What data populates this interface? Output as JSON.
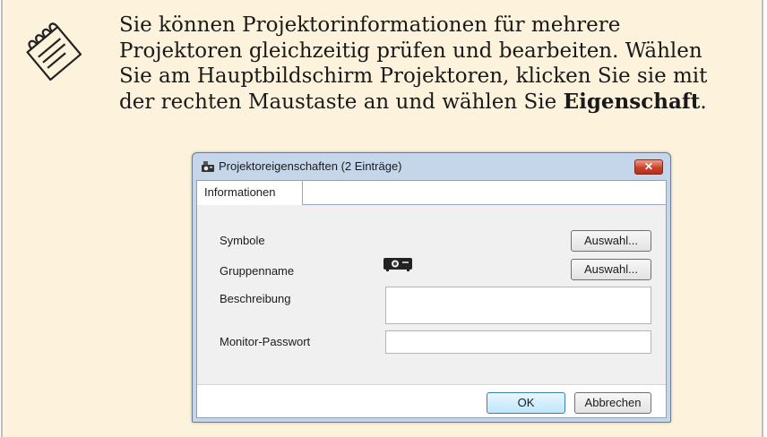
{
  "note": {
    "text_part1": "Sie können Projektorinformationen für mehrere Projektoren gleichzeitig prüfen und bearbeiten. Wählen Sie am Hauptbildschirm Projektoren, klicken Sie sie mit der rechten Maustaste an und wählen Sie ",
    "bold_term": "Eigenschaft",
    "text_part2": "."
  },
  "dialog": {
    "title": "Projektoreigenschaften (2 Einträge)",
    "close_label": "✕",
    "tab_label": "Informationen",
    "rows": {
      "symbol_label": "Symbole",
      "symbol_button": "Auswahl...",
      "group_label": "Gruppenname",
      "group_button": "Auswahl...",
      "description_label": "Beschreibung",
      "description_value": "",
      "monitor_password_label": "Monitor-Passwort",
      "monitor_password_value": ""
    },
    "ok_label": "OK",
    "cancel_label": "Abbrechen"
  },
  "icons": {
    "note": "note-pad-icon",
    "title": "projector-dialog-icon",
    "projector": "projector-icon"
  },
  "colors": {
    "note_background": "#fdf3dc",
    "dialog_frame": "#c5d6ea",
    "close_button": "#c9432a"
  }
}
